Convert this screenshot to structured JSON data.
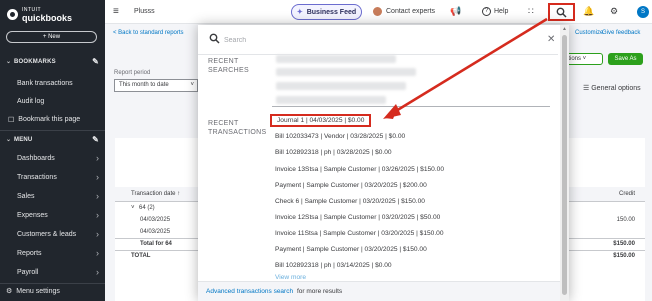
{
  "brand": {
    "line1": "INTUIT",
    "line2": "quickbooks"
  },
  "sidebar": {
    "new_label": "+ New",
    "bookmarks_header": "BOOKMARKS",
    "bookmarks": [
      "Bank transactions",
      "Audit log",
      "Bookmark this page"
    ],
    "menu_header": "MENU",
    "menu": [
      "Dashboards",
      "Transactions",
      "Sales",
      "Expenses",
      "Customers & leads",
      "Reports",
      "Payroll"
    ],
    "footer": "Menu settings"
  },
  "topbar": {
    "company": "Plusss",
    "business_feed": "Business Feed",
    "contact_experts": "Contact experts",
    "help": "Help",
    "avatar_initial": "S"
  },
  "page": {
    "back_link": "< Back to standard reports",
    "period_label": "Report period",
    "period_value": "This month to date",
    "customize": "Customize",
    "feedback": "Give feedback",
    "options_btn": "otions",
    "save_as": "Save As",
    "general_options": "General options",
    "table": {
      "col_date": "Transaction date",
      "col_credit": "Credit",
      "rows": [
        {
          "label": "64 (2)",
          "value": ""
        },
        {
          "label": "04/03/2025",
          "value": "150.00"
        },
        {
          "label": "04/03/2025",
          "value": ""
        },
        {
          "label": "Total for 64",
          "value": "$150.00"
        },
        {
          "label": "TOTAL",
          "value": "$150.00"
        }
      ]
    }
  },
  "search_modal": {
    "placeholder": "Search",
    "recent_searches_label": "RECENT\nSEARCHES",
    "recent_transactions_label": "RECENT\nTRANSACTIONS",
    "transactions": [
      "Journal 1 | 04/03/2025 | $0.00",
      "Bill 102033473 | Vendor | 03/28/2025 | $0.00",
      "Bill 102892318 | ph | 03/28/2025 | $0.00",
      "Invoice 13Stsa | Sample Customer | 03/26/2025 | $150.00",
      "Payment | Sample Customer | 03/20/2025 | $200.00",
      "Check 6 | Sample Customer | 03/20/2025 | $150.00",
      "Invoice 12Stsa | Sample Customer | 03/20/2025 | $50.00",
      "Invoice 11Stsa | Sample Customer | 03/20/2025 | $150.00",
      "Payment | Sample Customer | 03/20/2025 | $150.00",
      "Bill 102892318 | ph | 03/14/2025 | $0.00"
    ],
    "view_more": "View more",
    "footer_link": "Advanced transactions search",
    "footer_text": "for more results"
  },
  "colors": {
    "sidebar_bg": "#21262d",
    "accent_green": "#2ca01c",
    "link_blue": "#0077c5",
    "annotation_red": "#d52b1e"
  }
}
